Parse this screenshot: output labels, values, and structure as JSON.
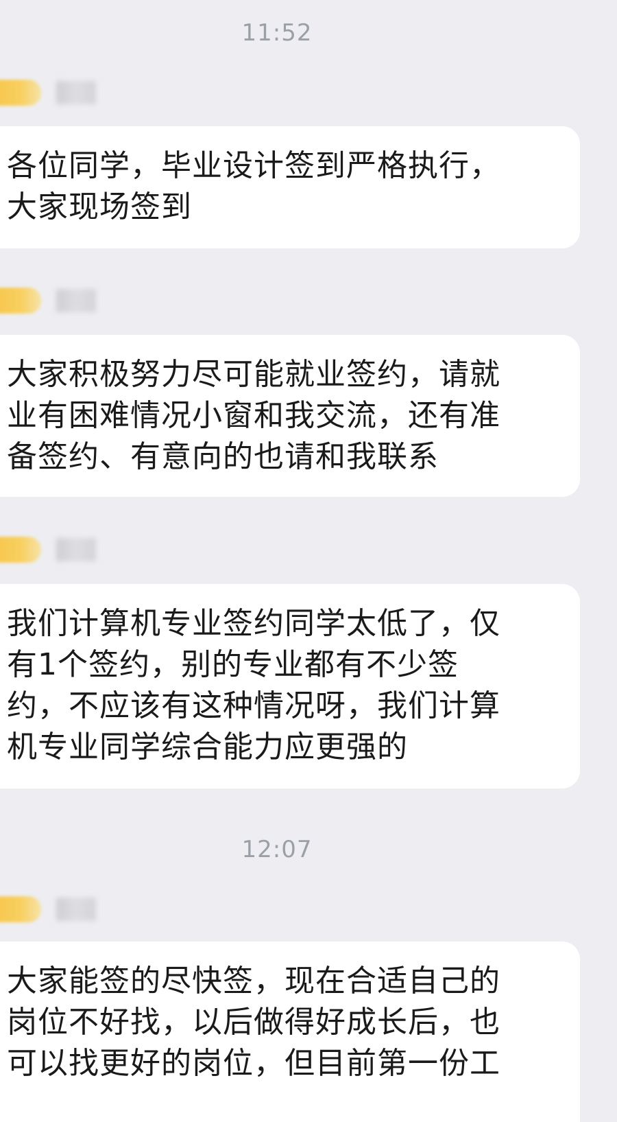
{
  "chat": {
    "timestamps": [
      "11:52",
      "12:07"
    ],
    "senders": [
      {
        "badge_icon": "member-level-badge"
      },
      {
        "badge_icon": "member-level-badge"
      },
      {
        "badge_icon": "member-level-badge"
      },
      {
        "badge_icon": "member-level-badge"
      }
    ],
    "messages": [
      {
        "text": "各位同学，毕业设计签到严格执行，\n大家现场签到"
      },
      {
        "text": "大家积极努力尽可能就业签约，请就\n业有困难情况小窗和我交流，还有准\n备签约、有意向的也请和我联系"
      },
      {
        "text": "我们计算机专业签约同学太低了，仅\n有1个签约，别的专业都有不少签\n约，不应该有这种情况呀，我们计算\n机专业同学综合能力应更强的"
      },
      {
        "text": "大家能签的尽快签，现在合适自己的\n岗位不好找，以后做得好成长后，也\n可以找更好的岗位，但目前第一份工"
      }
    ]
  },
  "colors": {
    "background": "#eeeef2",
    "bubble": "#ffffff",
    "text": "#1a1a1a",
    "timestamp": "#9aa0a6",
    "badge": "#f6c64a"
  }
}
